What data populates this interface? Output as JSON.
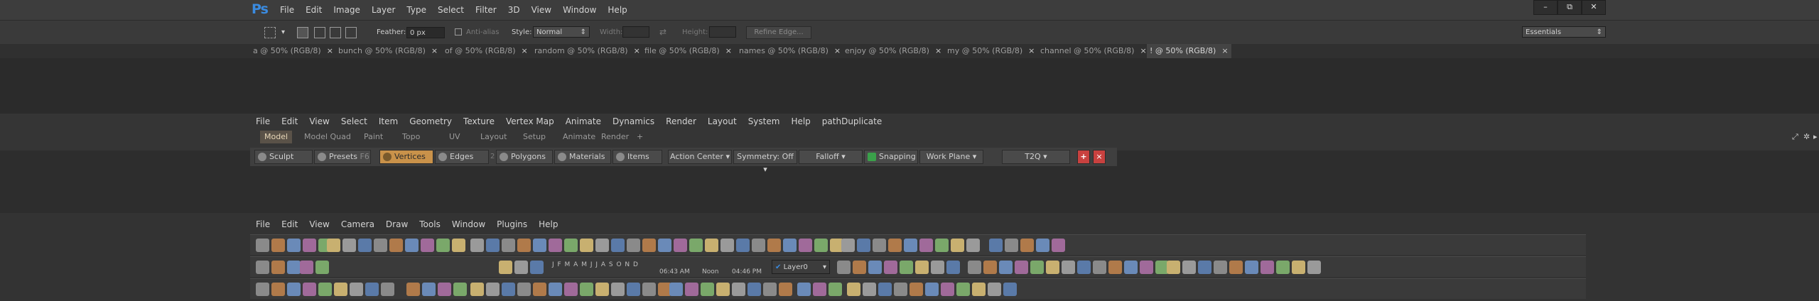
{
  "photoshop": {
    "logo": "Ps",
    "menu": [
      "File",
      "Edit",
      "Image",
      "Layer",
      "Type",
      "Select",
      "Filter",
      "3D",
      "View",
      "Window",
      "Help"
    ],
    "window_controls": [
      "–",
      "⧉",
      "✕"
    ],
    "options": {
      "feather_label": "Feather:",
      "feather_value": "0 px",
      "antialias_label": "Anti-alias",
      "style_label": "Style:",
      "style_value": "Normal",
      "width_label": "Width:",
      "height_label": "Height:",
      "refine_edge": "Refine Edge...",
      "workspace": "Essentials"
    },
    "tabs": [
      {
        "label": "a @ 50% (RGB/8)"
      },
      {
        "label": "bunch @ 50% (RGB/8)"
      },
      {
        "label": "of @ 50% (RGB/8)"
      },
      {
        "label": "random @ 50% (RGB/8)"
      },
      {
        "label": "file @ 50% (RGB/8)"
      },
      {
        "label": "names @ 50% (RGB/8)"
      },
      {
        "label": "enjoy @ 50% (RGB/8)"
      },
      {
        "label": "my @ 50% (RGB/8)"
      },
      {
        "label": "channel @ 50% (RGB/8)"
      },
      {
        "label": "! @ 50% (RGB/8)"
      }
    ],
    "tab_close": "×"
  },
  "modo": {
    "menu": [
      "File",
      "Edit",
      "View",
      "Select",
      "Item",
      "Geometry",
      "Texture",
      "Vertex Map",
      "Animate",
      "Dynamics",
      "Render",
      "Layout",
      "System",
      "Help",
      "pathDuplicate"
    ],
    "tabs": [
      "Model",
      "Model Quad",
      "Paint",
      "Topo",
      "UV",
      "Layout",
      "Setup",
      "Animate",
      "Render",
      "+"
    ],
    "tools": {
      "sculpt": "Sculpt",
      "presets": "Presets",
      "presets_key": "F6",
      "vertices": "Vertices",
      "edges_key": "2",
      "edges": "Edges",
      "polygons": "Polygons",
      "materials": "Materials",
      "items": "Items",
      "action_center": "Action Center",
      "symmetry": "Symmetry: Off",
      "falloff": "Falloff",
      "snapping": "Snapping",
      "work_plane": "Work Plane",
      "t2q": "T2Q"
    },
    "accent_colors": {
      "selected": "#c9924a",
      "red_button": "#c8413f"
    }
  },
  "maya": {
    "menu": [
      "File",
      "Edit",
      "View",
      "Camera",
      "Draw",
      "Tools",
      "Window",
      "Plugins",
      "Help"
    ],
    "months": "J  F  M  A  M  J  J  A  S  O  N  D",
    "time_start": "06:43 AM",
    "time_noon": "Noon",
    "time_end": "04:46 PM",
    "layer": "Layer0"
  }
}
